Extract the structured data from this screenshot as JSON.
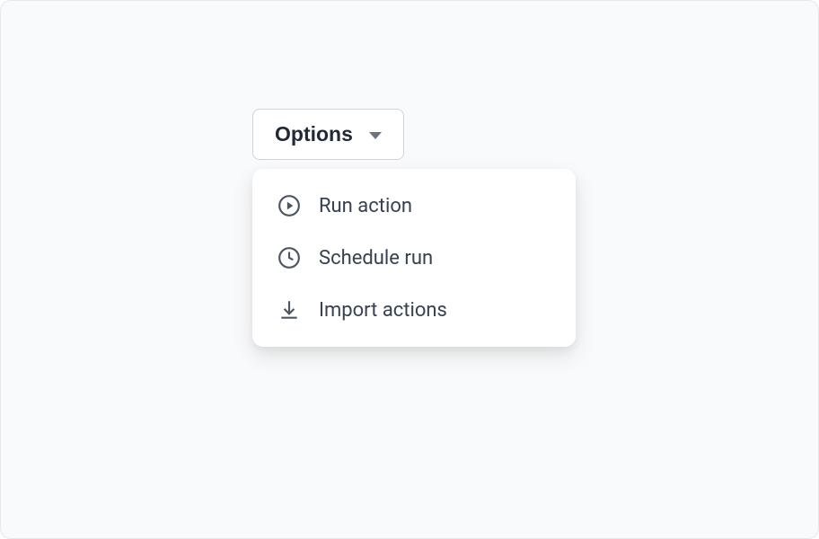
{
  "dropdown": {
    "button_label": "Options",
    "items": [
      {
        "icon": "play-circle",
        "label": "Run action"
      },
      {
        "icon": "clock",
        "label": "Schedule run"
      },
      {
        "icon": "download",
        "label": "Import actions"
      }
    ]
  }
}
